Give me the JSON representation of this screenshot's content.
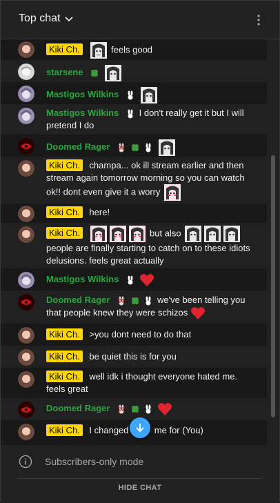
{
  "header": {
    "title": "Top chat",
    "chevron_icon": "chevron-down-icon",
    "menu_icon": "kebab-menu-icon"
  },
  "messages": [
    {
      "author": "Kiki Ch.",
      "owner": true,
      "text": "feels good",
      "emotes_before": 1
    },
    {
      "author": "starsene",
      "owner": false,
      "text": "",
      "badges": [
        "clover"
      ],
      "emotes_after": 1
    },
    {
      "author": "Mastigos Wilkins",
      "owner": false,
      "text": "",
      "badges": [
        "bunny"
      ],
      "emotes_after": 1
    },
    {
      "author": "Mastigos Wilkins",
      "owner": false,
      "text": "I don't really get it but I will pretend I do",
      "badges": [
        "bunny"
      ]
    },
    {
      "author": "Doomed Rager",
      "owner": false,
      "text": "",
      "badges": [
        "bunny-x",
        "clover",
        "bunny"
      ],
      "emotes_after": 1
    },
    {
      "author": "Kiki Ch.",
      "owner": true,
      "text": "champa... ok ill stream earlier and then stream again tomorrow morning so you can watch ok!! dont even give it a worry",
      "emotes_after": 1
    },
    {
      "author": "Kiki Ch.",
      "owner": true,
      "text": "here!"
    },
    {
      "author": "Kiki Ch.",
      "owner": true,
      "text_a": "but also",
      "text_b": "people are finally starting to catch on to these idiots delusions. feels great actually"
    },
    {
      "author": "Mastigos Wilkins",
      "owner": false,
      "text": "",
      "badges": [
        "bunny"
      ],
      "heart": true
    },
    {
      "author": "Doomed Rager",
      "owner": false,
      "text": "we've been telling you that people knew they were schizos",
      "badges": [
        "bunny-x",
        "clover",
        "bunny"
      ],
      "heart": true
    },
    {
      "author": "Kiki Ch.",
      "owner": true,
      "text": ">you dont need to do that"
    },
    {
      "author": "Kiki Ch.",
      "owner": true,
      "text": "be quiet this is for you"
    },
    {
      "author": "Kiki Ch.",
      "owner": true,
      "text": "well idk i thought everyone hated me. feels great"
    },
    {
      "author": "Doomed Rager",
      "owner": false,
      "text": "",
      "badges": [
        "bunny-x",
        "clover",
        "bunny"
      ],
      "heart": true
    },
    {
      "author": "Kiki Ch.",
      "owner": true,
      "text": "I changed the theme for (You)",
      "text_visible": "I changed",
      "text_visible_tail": "me for (You)"
    }
  ],
  "footer": {
    "mode_text": "Subscribers-only mode",
    "hide_label": "HIDE CHAT"
  },
  "colors": {
    "owner_badge_bg": "#ffd600",
    "member_name": "#2ba640",
    "jump_button": "#3ea6ff"
  }
}
